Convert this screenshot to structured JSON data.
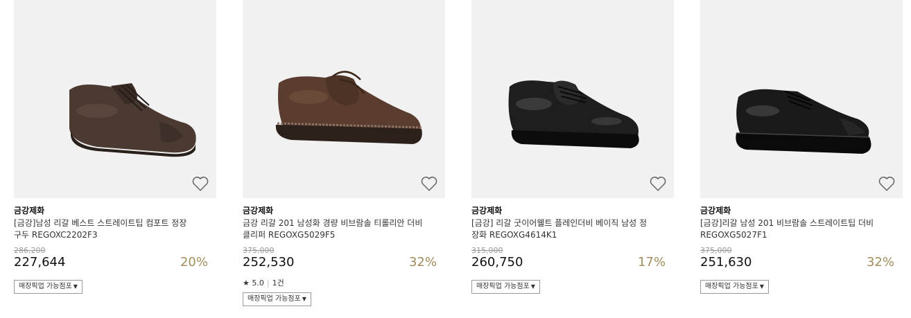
{
  "products": [
    {
      "brand": "금강제화",
      "title": "[금강]남성 리갈 베스트 스트레이트팁 컴포트 정장구두 REGOXC2202F3",
      "original_price": "286,200",
      "price": "227,644",
      "discount": "20%",
      "pickup_label": "매장픽업 가능점포",
      "shoe_color": "#4b3a32"
    },
    {
      "brand": "금강제화",
      "title": "금강 리갈 201 남성화 경량 비브람솔 티롤리안 더비 클리퍼 REGOXG5029F5",
      "original_price": "375,000",
      "price": "252,530",
      "discount": "32%",
      "rating_star": "★",
      "rating_score": "5.0",
      "rating_count": "1건",
      "pickup_label": "매장픽업 가능점포",
      "shoe_color": "#5a3d2e"
    },
    {
      "brand": "금강제화",
      "title": "[금강] 리갈 굿이어웰트 플레인더비 베이직 남성 정장화 REGOXG4614K1",
      "original_price": "315,000",
      "price": "260,750",
      "discount": "17%",
      "pickup_label": "매장픽업 가능점포",
      "shoe_color": "#1e1e1e"
    },
    {
      "brand": "금강제화",
      "title": "[금강]리갈 남성 201 비브람솔 스트레이트팁 더비 REGOXG5027F1",
      "original_price": "375,000",
      "price": "251,630",
      "discount": "32%",
      "pickup_label": "매장픽업 가능점포",
      "shoe_color": "#1a1a1a"
    }
  ],
  "icons": {
    "wishlist": "heart-outline-icon",
    "dropdown": "caret-down-icon"
  },
  "colors": {
    "discount": "#a08d5d",
    "image_bg": "#f1f1f1"
  }
}
